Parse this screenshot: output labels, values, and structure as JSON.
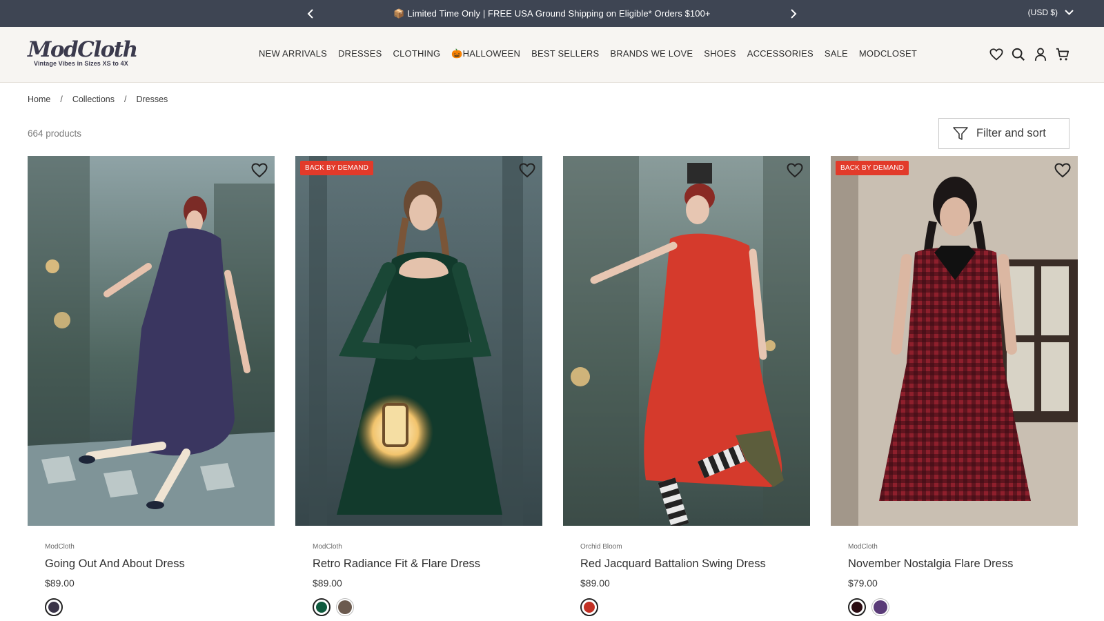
{
  "announcement": {
    "message": "📦 Limited Time Only | FREE USA Ground Shipping on Eligible* Orders $100+",
    "currency": "(USD $)"
  },
  "header": {
    "logo": "ModCloth",
    "tagline": "Vintage Vibes in Sizes XS to 4X",
    "nav": [
      "NEW ARRIVALS",
      "DRESSES",
      "CLOTHING",
      "🎃HALLOWEEN",
      "BEST SELLERS",
      "BRANDS WE LOVE",
      "SHOES",
      "ACCESSORIES",
      "SALE",
      "MODCLOSET"
    ],
    "icons": [
      "heart-icon",
      "search-icon",
      "account-icon",
      "cart-icon"
    ]
  },
  "breadcrumb": [
    "Home",
    "Collections",
    "Dresses"
  ],
  "product_count": "664 products",
  "filter_label": "Filter and sort",
  "colors": {
    "announcement_bg": "#3e4553",
    "header_bg": "#f7f5f2",
    "badge": "#e23a2a"
  },
  "products": [
    {
      "vendor": "ModCloth",
      "title": "Going Out And About Dress",
      "price": "$89.00",
      "badge": "",
      "swatches": [
        "#3a3448"
      ]
    },
    {
      "vendor": "ModCloth",
      "title": "Retro Radiance Fit & Flare Dress",
      "price": "$89.00",
      "badge": "BACK BY DEMAND",
      "swatches": [
        "#0f5a3e",
        "#6b5a4e"
      ]
    },
    {
      "vendor": "Orchid Bloom",
      "title": "Red Jacquard Battalion Swing Dress",
      "price": "$89.00",
      "badge": "",
      "swatches": [
        "#c23024"
      ]
    },
    {
      "vendor": "ModCloth",
      "title": "November Nostalgia Flare Dress",
      "price": "$79.00",
      "badge": "BACK BY DEMAND",
      "swatches": [
        "#2a0c12",
        "#5a3b78"
      ]
    }
  ]
}
